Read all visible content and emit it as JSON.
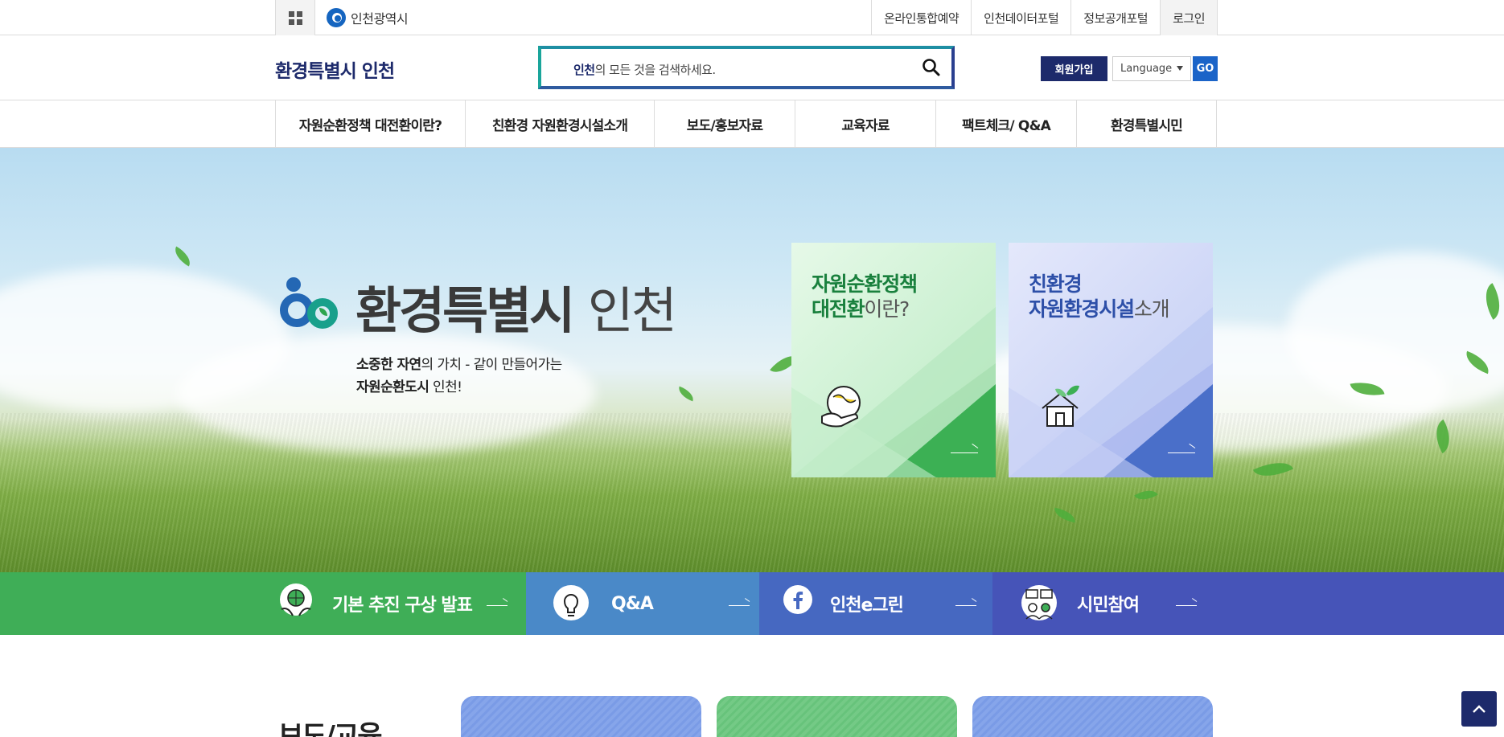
{
  "util": {
    "city_logo_text": "인천광역시",
    "links": [
      "온라인통합예약",
      "인천데이터포털",
      "정보공개포털",
      "로그인"
    ]
  },
  "header": {
    "site_title": "환경특별시 인천",
    "search_highlight": "인천",
    "search_rest": "의 모든 것을 검색하세요.",
    "join_label": "회원가입",
    "language_value": "Language",
    "go_label": "GO"
  },
  "gnb": {
    "items": [
      "자원순환정책 대전환이란?",
      "친환경 자원환경시설소개",
      "보도/홍보자료",
      "교육자료",
      "팩트체크/ Q&A",
      "환경특별시민"
    ]
  },
  "hero": {
    "logo_bold": "환경특별시",
    "logo_light": "인천",
    "slogan_line1_bold": "소중한 자연",
    "slogan_line1_rest": "의 가치 - 같이 만들어가는",
    "slogan_line2_bold": "자원순환도시",
    "slogan_line2_rest": " 인천!",
    "cards": [
      {
        "title_bold_1": "자원순환정책",
        "title_bold_2": "대전환",
        "title_light": "이란?",
        "color": "#19803d"
      },
      {
        "title_bold_1": "친환경",
        "title_bold_2": "자원환경시설",
        "title_light": "소개",
        "color": "#2d4fa8"
      }
    ]
  },
  "quick": {
    "items": [
      {
        "label": "기본 추진 구상 발표",
        "color": "#3fae57"
      },
      {
        "label": "Q&A",
        "color": "#4a89c8"
      },
      {
        "label": "인천e그린",
        "color": "#4668c1"
      },
      {
        "label": "시민참여",
        "color": "#4654b8"
      }
    ]
  },
  "bottom": {
    "section_title": "보도/교육"
  },
  "colors": {
    "navy": "#1d2a6b",
    "go_blue": "#1b64c8",
    "green": "#3fae57"
  }
}
